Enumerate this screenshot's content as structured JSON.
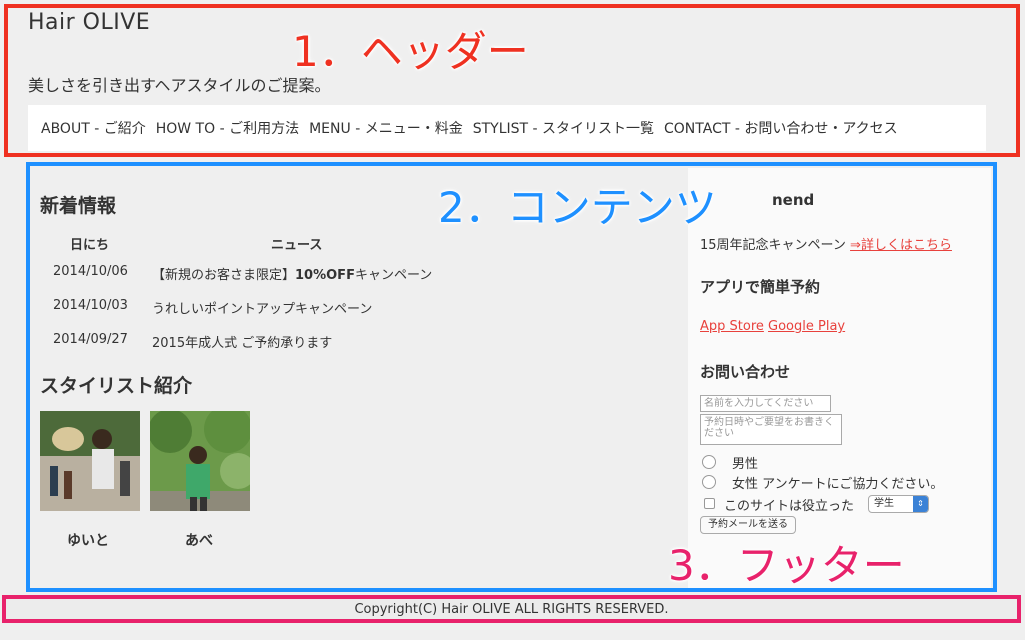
{
  "header": {
    "logo": "Hair OLIVE",
    "tagline": "美しさを引き出すヘアスタイルのご提案。",
    "nav": [
      "ABOUT - ご紹介",
      "HOW TO - ご利用方法",
      "MENU - メニュー・料金",
      "STYLIST - スタイリスト一覧",
      "CONTACT - お問い合わせ・アクセス"
    ]
  },
  "annotations": {
    "header": "1．ヘッダー",
    "content": "2．コンテンツ",
    "footer": "3．フッター"
  },
  "news": {
    "title": "新着情報",
    "col_date": "日にち",
    "col_news": "ニュース",
    "rows": [
      {
        "date": "2014/10/06",
        "text": "【新規のお客さま限定】10%OFFキャンペーン"
      },
      {
        "date": "2014/10/03",
        "text": "うれしいポイントアップキャンペーン"
      },
      {
        "date": "2014/09/27",
        "text": "2015年成人式 ご予約承ります"
      }
    ]
  },
  "stylists": {
    "title": "スタイリスト紹介",
    "people": [
      {
        "name": "ゆいと"
      },
      {
        "name": "あべ"
      }
    ]
  },
  "sidebar": {
    "recommend_title": "nend",
    "recommend_text": "15周年記念キャンペーン",
    "recommend_link": "⇒詳しくはこちら",
    "app_title": "アプリで簡単予約",
    "app_store": "App Store",
    "google_play": "Google Play",
    "contact_title": "お問い合わせ",
    "name_placeholder": "名前を入力してください",
    "message_placeholder": "予約日時やご要望をお書きください",
    "radio_male": "男性",
    "radio_female": "女性",
    "survey_text": "アンケートにご協力ください。",
    "checkbox_label": "このサイトは役立った",
    "select_value": "学生",
    "submit_label": "予約メールを送る"
  },
  "footer": {
    "copyright": "Copyright(C) Hair OLIVE ALL RIGHTS RESERVED."
  },
  "colors": {
    "header_border": "#ef3121",
    "content_border": "#1e90ff",
    "footer_border": "#e8226b",
    "link": "#e8413c"
  }
}
